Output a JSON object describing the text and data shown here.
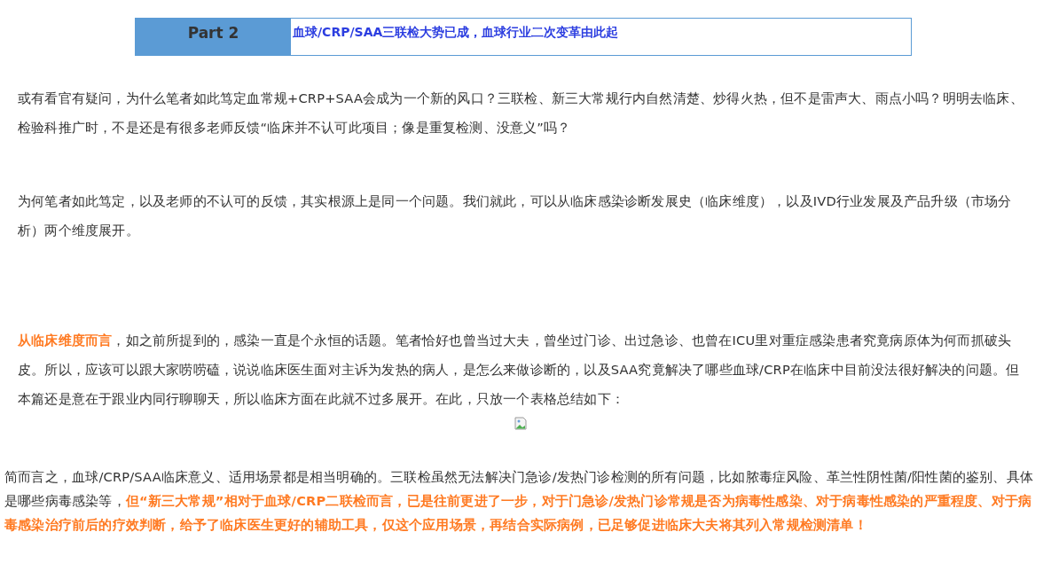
{
  "section_header": {
    "part_label": "Part 2",
    "title": "血球/CRP/SAA三联检大势已成，血球行业二次变革由此起"
  },
  "paragraphs": [
    {
      "kind": "text",
      "text": "或有看官有疑问，为什么笔者如此笃定血常规+CRP+SAA会成为一个新的风口？三联检、新三大常规行内自然清楚、炒得火热，但不是雷声大、雨点小吗？明明去临床、检验科推广时，不是还是有很多老师反馈“临床并不认可此项目；像是重复检测、没意义”吗？"
    },
    {
      "kind": "text",
      "text": "为何笔者如此笃定，以及老师的不认可的反馈，其实根源上是同一个问题。我们就此，可以从临床感染诊断发展史（临床维度），以及IVD行业发展及产品升级（市场分析）两个维度展开。"
    },
    {
      "kind": "text",
      "text": "**从临床维度而言**，如之前所提到的，感染一直是个永恒的话题。笔者恰好也曾当过大夫，曾坐过门诊、出过急诊、也曾在ICU里对重症感染患者究竟病原体为何而抓破头皮。所以，应该可以跟大家唠唠磕，说说临床医生面对主诉为发热的病人，是怎么来做诊断的，以及SAA究竟解决了哪些血球/CRP在临床中目前没法很好解决的问题。但本篇还是意在于跟业内同行聊聊天，所以临床方面在此就不过多展开。在此，只放一个表格总结如下："
    },
    {
      "kind": "image"
    },
    {
      "kind": "summary",
      "text": "简而言之，血球/CRP/SAA临床意义、适用场景都是相当明确的。三联检虽然无法解决门急诊/发热门诊检测的所有问题，比如脓毒症风险、革兰性阴性菌/阳性菌的鉴别、具体是哪些病毒感染等，**但“新三大常规”相对于血球/CRP二联检而言，已是往前更进了一步，对于门急诊/发热门诊常规是否为病毒性感染、对于病毒性感染的严重程度、对于病毒感染治疗前后的疗效判断，给予了临床医生更好的辅助工具，仅这个应用场景，再结合实际病例，已足够促进临床大夫将其列入常规检测清单！**"
    }
  ]
}
